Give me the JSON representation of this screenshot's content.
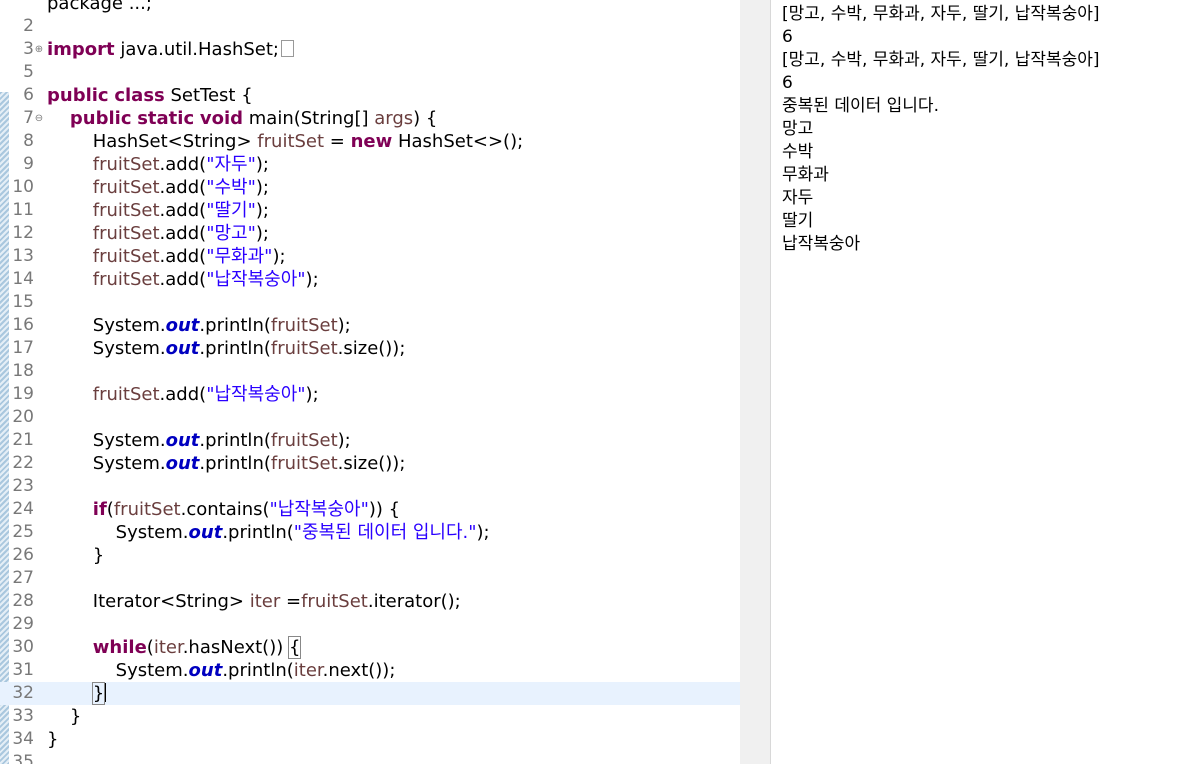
{
  "editor": {
    "lines": [
      {
        "n": "",
        "tokens": [
          {
            "t": "plain",
            "v": "package ...;"
          }
        ]
      },
      {
        "n": "2",
        "tokens": []
      },
      {
        "n": "3",
        "fold": "⊕",
        "ellipsis": true,
        "tokens": [
          {
            "t": "kw",
            "v": "import"
          },
          {
            "t": "plain",
            "v": " java.util.HashSet;"
          }
        ]
      },
      {
        "n": "5",
        "tokens": []
      },
      {
        "n": "6",
        "tokens": [
          {
            "t": "kw",
            "v": "public"
          },
          {
            "t": "plain",
            "v": " "
          },
          {
            "t": "kw",
            "v": "class"
          },
          {
            "t": "plain",
            "v": " SetTest {"
          }
        ]
      },
      {
        "n": "7",
        "fold": "⊖",
        "tokens": [
          {
            "t": "plain",
            "v": "    "
          },
          {
            "t": "kw",
            "v": "public"
          },
          {
            "t": "plain",
            "v": " "
          },
          {
            "t": "kw",
            "v": "static"
          },
          {
            "t": "plain",
            "v": " "
          },
          {
            "t": "kw",
            "v": "void"
          },
          {
            "t": "plain",
            "v": " main(String[] "
          },
          {
            "t": "var",
            "v": "args"
          },
          {
            "t": "plain",
            "v": ") {"
          }
        ]
      },
      {
        "n": "8",
        "tokens": [
          {
            "t": "plain",
            "v": "        HashSet<String> "
          },
          {
            "t": "var",
            "v": "fruitSet"
          },
          {
            "t": "plain",
            "v": " = "
          },
          {
            "t": "kw",
            "v": "new"
          },
          {
            "t": "plain",
            "v": " HashSet<>();"
          }
        ]
      },
      {
        "n": "9",
        "tokens": [
          {
            "t": "plain",
            "v": "        "
          },
          {
            "t": "var",
            "v": "fruitSet"
          },
          {
            "t": "plain",
            "v": ".add("
          },
          {
            "t": "str",
            "v": "\"자두\""
          },
          {
            "t": "plain",
            "v": ");"
          }
        ]
      },
      {
        "n": "10",
        "tokens": [
          {
            "t": "plain",
            "v": "        "
          },
          {
            "t": "var",
            "v": "fruitSet"
          },
          {
            "t": "plain",
            "v": ".add("
          },
          {
            "t": "str",
            "v": "\"수박\""
          },
          {
            "t": "plain",
            "v": ");"
          }
        ]
      },
      {
        "n": "11",
        "tokens": [
          {
            "t": "plain",
            "v": "        "
          },
          {
            "t": "var",
            "v": "fruitSet"
          },
          {
            "t": "plain",
            "v": ".add("
          },
          {
            "t": "str",
            "v": "\"딸기\""
          },
          {
            "t": "plain",
            "v": ");"
          }
        ]
      },
      {
        "n": "12",
        "tokens": [
          {
            "t": "plain",
            "v": "        "
          },
          {
            "t": "var",
            "v": "fruitSet"
          },
          {
            "t": "plain",
            "v": ".add("
          },
          {
            "t": "str",
            "v": "\"망고\""
          },
          {
            "t": "plain",
            "v": ");"
          }
        ]
      },
      {
        "n": "13",
        "tokens": [
          {
            "t": "plain",
            "v": "        "
          },
          {
            "t": "var",
            "v": "fruitSet"
          },
          {
            "t": "plain",
            "v": ".add("
          },
          {
            "t": "str",
            "v": "\"무화과\""
          },
          {
            "t": "plain",
            "v": ");"
          }
        ]
      },
      {
        "n": "14",
        "tokens": [
          {
            "t": "plain",
            "v": "        "
          },
          {
            "t": "var",
            "v": "fruitSet"
          },
          {
            "t": "plain",
            "v": ".add("
          },
          {
            "t": "str",
            "v": "\"납작복숭아\""
          },
          {
            "t": "plain",
            "v": ");"
          }
        ]
      },
      {
        "n": "15",
        "tokens": []
      },
      {
        "n": "16",
        "tokens": [
          {
            "t": "plain",
            "v": "        System."
          },
          {
            "t": "fld",
            "v": "out"
          },
          {
            "t": "plain",
            "v": ".println("
          },
          {
            "t": "var",
            "v": "fruitSet"
          },
          {
            "t": "plain",
            "v": ");"
          }
        ]
      },
      {
        "n": "17",
        "tokens": [
          {
            "t": "plain",
            "v": "        System."
          },
          {
            "t": "fld",
            "v": "out"
          },
          {
            "t": "plain",
            "v": ".println("
          },
          {
            "t": "var",
            "v": "fruitSet"
          },
          {
            "t": "plain",
            "v": ".size());"
          }
        ]
      },
      {
        "n": "18",
        "tokens": []
      },
      {
        "n": "19",
        "tokens": [
          {
            "t": "plain",
            "v": "        "
          },
          {
            "t": "var",
            "v": "fruitSet"
          },
          {
            "t": "plain",
            "v": ".add("
          },
          {
            "t": "str",
            "v": "\"납작복숭아\""
          },
          {
            "t": "plain",
            "v": ");"
          }
        ]
      },
      {
        "n": "20",
        "tokens": []
      },
      {
        "n": "21",
        "tokens": [
          {
            "t": "plain",
            "v": "        System."
          },
          {
            "t": "fld",
            "v": "out"
          },
          {
            "t": "plain",
            "v": ".println("
          },
          {
            "t": "var",
            "v": "fruitSet"
          },
          {
            "t": "plain",
            "v": ");"
          }
        ]
      },
      {
        "n": "22",
        "tokens": [
          {
            "t": "plain",
            "v": "        System."
          },
          {
            "t": "fld",
            "v": "out"
          },
          {
            "t": "plain",
            "v": ".println("
          },
          {
            "t": "var",
            "v": "fruitSet"
          },
          {
            "t": "plain",
            "v": ".size());"
          }
        ]
      },
      {
        "n": "23",
        "tokens": []
      },
      {
        "n": "24",
        "tokens": [
          {
            "t": "plain",
            "v": "        "
          },
          {
            "t": "kw",
            "v": "if"
          },
          {
            "t": "plain",
            "v": "("
          },
          {
            "t": "var",
            "v": "fruitSet"
          },
          {
            "t": "plain",
            "v": ".contains("
          },
          {
            "t": "str",
            "v": "\"납작복숭아\""
          },
          {
            "t": "plain",
            "v": ")) {"
          }
        ]
      },
      {
        "n": "25",
        "tokens": [
          {
            "t": "plain",
            "v": "            System."
          },
          {
            "t": "fld",
            "v": "out"
          },
          {
            "t": "plain",
            "v": ".println("
          },
          {
            "t": "str",
            "v": "\"중복된 데이터 입니다.\""
          },
          {
            "t": "plain",
            "v": ");"
          }
        ]
      },
      {
        "n": "26",
        "tokens": [
          {
            "t": "plain",
            "v": "        }"
          }
        ]
      },
      {
        "n": "27",
        "tokens": []
      },
      {
        "n": "28",
        "tokens": [
          {
            "t": "plain",
            "v": "        Iterator<String> "
          },
          {
            "t": "var",
            "v": "iter"
          },
          {
            "t": "plain",
            "v": " ="
          },
          {
            "t": "var",
            "v": "fruitSet"
          },
          {
            "t": "plain",
            "v": ".iterator();"
          }
        ]
      },
      {
        "n": "29",
        "tokens": []
      },
      {
        "n": "30",
        "tokens": [
          {
            "t": "plain",
            "v": "        "
          },
          {
            "t": "kw",
            "v": "while"
          },
          {
            "t": "plain",
            "v": "("
          },
          {
            "t": "var",
            "v": "iter"
          },
          {
            "t": "plain",
            "v": ".hasNext()) "
          },
          {
            "t": "boxed",
            "v": "{"
          }
        ]
      },
      {
        "n": "31",
        "tokens": [
          {
            "t": "plain",
            "v": "            System."
          },
          {
            "t": "fld",
            "v": "out"
          },
          {
            "t": "plain",
            "v": ".println("
          },
          {
            "t": "var",
            "v": "iter"
          },
          {
            "t": "plain",
            "v": ".next());"
          }
        ]
      },
      {
        "n": "32",
        "current": true,
        "caret": true,
        "tokens": [
          {
            "t": "plain",
            "v": "        "
          },
          {
            "t": "boxed",
            "v": "}"
          }
        ]
      },
      {
        "n": "33",
        "tokens": [
          {
            "t": "plain",
            "v": "    }"
          }
        ]
      },
      {
        "n": "34",
        "tokens": [
          {
            "t": "plain",
            "v": "}"
          }
        ]
      },
      {
        "n": "35",
        "tokens": []
      }
    ]
  },
  "console": {
    "lines": [
      "[망고, 수박, 무화과, 자두, 딸기, 납작복숭아]",
      "6",
      "[망고, 수박, 무화과, 자두, 딸기, 납작복숭아]",
      "6",
      "중복된 데이터 입니다.",
      "망고",
      "수박",
      "무화과",
      "자두",
      "딸기",
      "납작복숭아"
    ]
  },
  "colors": {
    "keyword": "#7f0055",
    "field": "#0000c0",
    "variable": "#6a3e3e",
    "string": "#2a00ff",
    "current_line": "#e8f2fe"
  }
}
